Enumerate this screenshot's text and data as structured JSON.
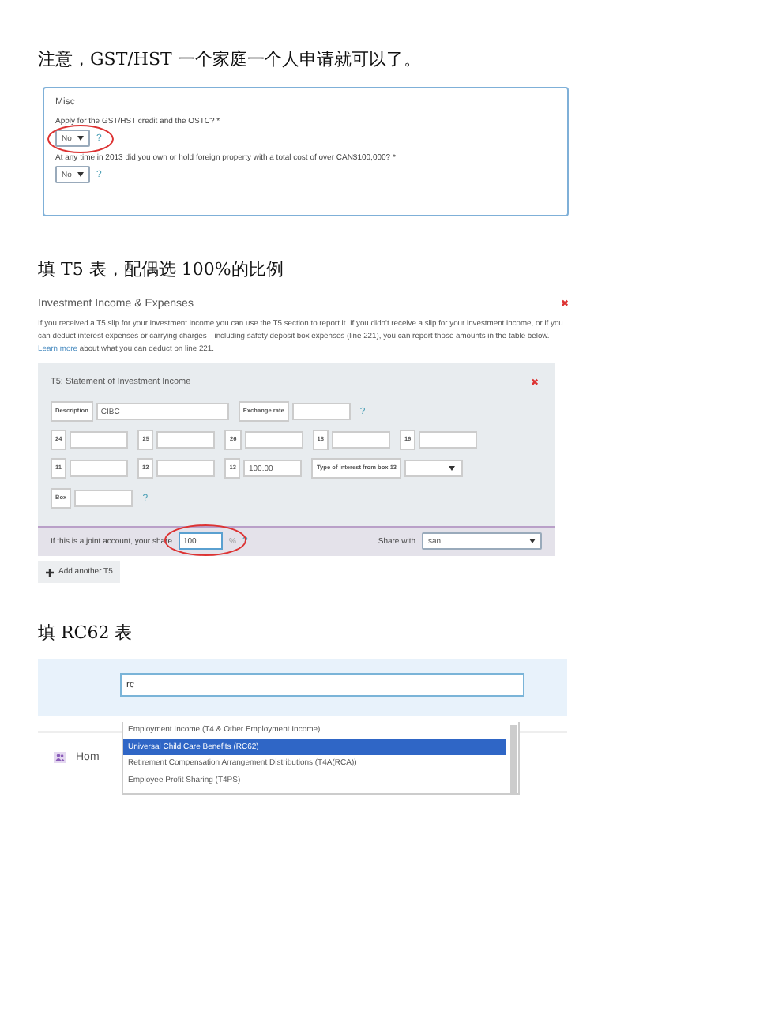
{
  "note_1": "注意，GST/HST 一个家庭一个人申请就可以了。",
  "misc": {
    "title": "Misc",
    "questions": [
      {
        "label": "Apply for the GST/HST credit and the OSTC? *",
        "value": "No",
        "help": "?",
        "circled": true
      },
      {
        "label": "At any time in 2013 did you own or hold foreign property with a total cost of over CAN$100,000? *",
        "value": "No",
        "help": "?"
      }
    ]
  },
  "note_2": "填 T5 表，配偶选 100%的比例",
  "investment": {
    "title": "Investment Income & Expenses",
    "close": "✖",
    "intro_start": "If you received a T5 slip for your investment income you can use the T5 section to report it. If you didn't receive a slip for your investment income, or if you can deduct interest expenses or carrying charges—including safety deposit box expenses (line 221), you can report those amounts in the table below. ",
    "intro_link": "Learn more",
    "intro_end": " about what you can deduct on line 221.",
    "t5": {
      "title": "T5: Statement of Investment Income",
      "close": "✖",
      "rows": [
        [
          {
            "kind": "wide",
            "label": "Description",
            "value": "CIBC"
          },
          {
            "kind": "field",
            "label": "Exchange rate"
          },
          {
            "kind": "help",
            "text": "?"
          }
        ],
        [
          {
            "kind": "field",
            "label": "24"
          },
          {
            "kind": "field",
            "label": "25"
          },
          {
            "kind": "field",
            "label": "26"
          },
          {
            "kind": "field",
            "label": "18"
          },
          {
            "kind": "field",
            "label": "16"
          }
        ],
        [
          {
            "kind": "field",
            "label": "11"
          },
          {
            "kind": "field",
            "label": "12"
          },
          {
            "kind": "field",
            "label": "13",
            "value": "100.00"
          },
          {
            "kind": "select",
            "label": "Type of interest from box 13"
          }
        ],
        [
          {
            "kind": "field",
            "label": "Box"
          },
          {
            "kind": "help",
            "text": "?"
          }
        ]
      ],
      "joint": {
        "label": "If this is a joint account, your share",
        "value": "100",
        "unit": "%",
        "help": "?",
        "circled": true,
        "share_label": "Share with",
        "share_value": "san"
      }
    },
    "add_button": "Add another T5"
  },
  "note_3": "填 RC62 表",
  "search": {
    "value": "rc",
    "results": [
      {
        "text": "Employment Income (T4 & Other Employment Income)",
        "selected": false
      },
      {
        "text": "Universal Child Care Benefits (RC62)",
        "selected": true
      },
      {
        "text": "Retirement Compensation Arrangement Distributions (T4A(RCA))",
        "selected": false
      },
      {
        "text": "Employee Profit Sharing (T4PS)",
        "selected": false
      }
    ]
  },
  "behind_label": "Hom"
}
